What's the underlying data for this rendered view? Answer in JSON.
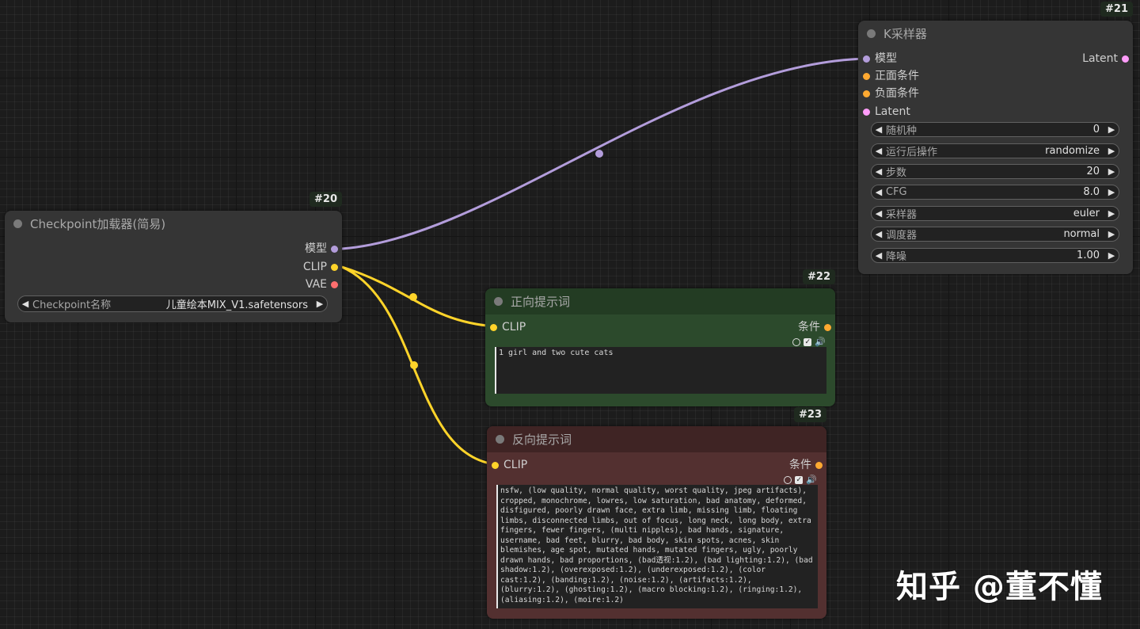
{
  "colors": {
    "model": "#b39ddb",
    "clip": "#ffd42a",
    "vae": "#ff6e6e",
    "conditioning": "#ffa931",
    "latent": "#ff9cf9",
    "positive_bg": "#2c4a2c",
    "positive_title": "#233c23",
    "negative_bg": "#533030",
    "negative_title": "#3f2424"
  },
  "nodes": {
    "checkpoint": {
      "id": "#20",
      "title": "Checkpoint加载器(简易)",
      "outputs": [
        "模型",
        "CLIP",
        "VAE"
      ],
      "widget": {
        "name": "Checkpoint名称",
        "value": "儿童绘本MIX_V1.safetensors"
      }
    },
    "ksampler": {
      "id": "#21",
      "title": "K采样器",
      "inputs": [
        "模型",
        "正面条件",
        "负面条件",
        "Latent"
      ],
      "output": "Latent",
      "widgets": [
        {
          "name": "随机种",
          "value": "0"
        },
        {
          "name": "运行后操作",
          "value": "randomize"
        },
        {
          "name": "步数",
          "value": "20"
        },
        {
          "name": "CFG",
          "value": "8.0"
        },
        {
          "name": "采样器",
          "value": "euler"
        },
        {
          "name": "调度器",
          "value": "normal"
        },
        {
          "name": "降噪",
          "value": "1.00"
        }
      ]
    },
    "positive": {
      "id": "#22",
      "title": "正向提示词",
      "input": "CLIP",
      "output": "条件",
      "text": "1 girl and two cute cats"
    },
    "negative": {
      "id": "#23",
      "title": "反向提示词",
      "input": "CLIP",
      "output": "条件",
      "text": "nsfw, (low quality, normal quality, worst quality, jpeg artifacts), cropped, monochrome, lowres, low saturation, bad anatomy, deformed, disfigured, poorly drawn face, extra limb, missing limb, floating limbs, disconnected limbs, out of focus, long neck, long body, extra fingers, fewer fingers, (multi nipples), bad hands, signature, username, bad feet, blurry, bad body, skin spots, acnes, skin blemishes, age spot, mutated hands, mutated fingers, ugly, poorly drawn hands, bad proportions, (bad透视:1.2), (bad lighting:1.2), (bad shadow:1.2), (overexposed:1.2), (underexposed:1.2), (color cast:1.2), (banding:1.2), (noise:1.2), (artifacts:1.2), (blurry:1.2), (ghosting:1.2), (macro blocking:1.2), (ringing:1.2), (aliasing:1.2), (moire:1.2)"
    }
  },
  "watermark": "知乎 @董不懂"
}
